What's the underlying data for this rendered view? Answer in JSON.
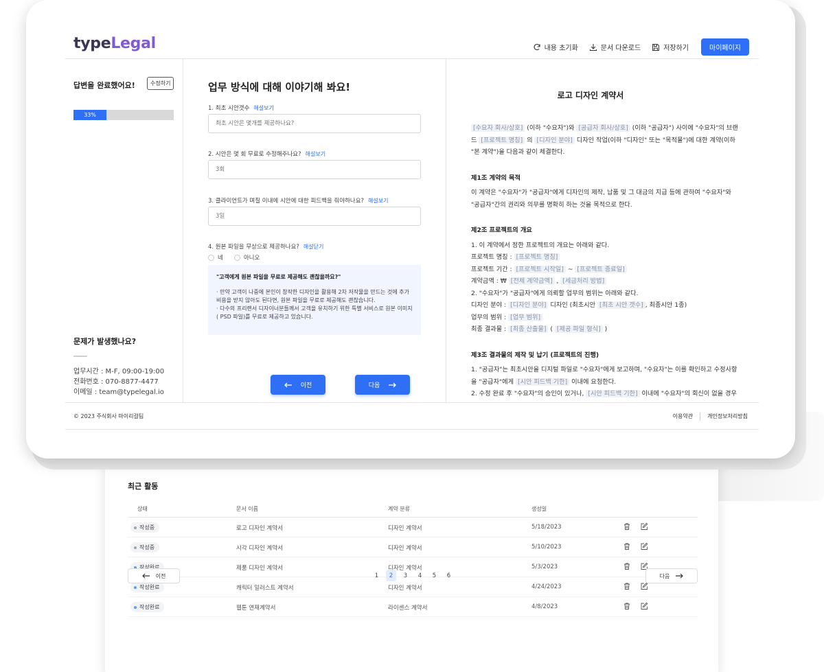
{
  "header": {
    "logo_part1": "type",
    "logo_part2": "Legal",
    "reset_label": "내용 초기화",
    "download_label": "문서 다운로드",
    "save_label": "저장하기",
    "mypage_label": "마이페이지"
  },
  "sidebar": {
    "done_text": "답변을 완료했어요!",
    "edit_label": "수정하기",
    "progress_label": "33%",
    "progress_value": 0.33,
    "problem_title": "문제가 발생했나요?",
    "hours": "업무시간 : M-F, 09:00-19:00",
    "phone": "전화번호 : 070-8877-4477",
    "email": "이메일 : team@typelegal.io"
  },
  "questions": {
    "title": "업무 방식에 대해 이야기해 봐요!",
    "hint_show": "해설보기",
    "hint_hide": "해설닫기",
    "q1_label": "1. 최초 시안갯수",
    "q1_placeholder": "최초 시안은 몇개를 제공하나요?",
    "q2_label": "2. 시안은 몇 회 무료로 수정해주나요?",
    "q2_placeholder": "3회",
    "q3_label": "3. 클라이언트가 며칠 이내에 시안에 대한 피드백을 줘야하나요?",
    "q3_placeholder": "3일",
    "q4_label": "4. 원본 파일을 무상으로 제공하나요?",
    "yes_label": "네",
    "no_label": "아니오",
    "tip_question": "\"고객에게 원본 파일을 무료로 제공해도 괜찮을까요?\"",
    "tip_line1": "· 만약 고객이 나중에 본인이 창작한 디자인을 활용해 2차 저작물을 만드는 것에 추가 비용을 받지 않아도 된다면, 원본 파일을 무료로 제공해도 괜찮습니다.",
    "tip_line2": "· 다수의 프리랜서 디자이너분들께서 고객을 유치하기 위한 특별 서비스로 원본 이미지( PSD 파일)를 무료로 제공하고 있습니다.",
    "prev_label": "이전",
    "next_label": "다음"
  },
  "document": {
    "title": "로고 디자인 계약서",
    "ph_client": "[수요자 회사/상호]",
    "t_intro1": " (이하 \"수요자\")와 ",
    "ph_provider": "[공급자 회사/상호]",
    "t_intro2": " (이하 \"공급자\") 사이에 \"수요자\"의 브랜드 ",
    "ph_project": "[프로젝트 명칭]",
    "t_intro3": " 의 ",
    "ph_field": "[디자인 분야]",
    "t_intro4": " 디자인 작업(이하 \"디자인\" 또는 \"목적물\")에 대한 계약(이하 \"본 계약\")을 다음과 같이 체결한다.",
    "sec1_title": "제1조 계약의 목적",
    "sec1_body": "이 계약은 \"수요자\"가 \"공급자\"에게 디자인의 제작, 납품 및 그 대금의 지급 등에 관하여 \"수요자\"와 \"공급자\"간의 권리와 의무를 명확히 하는 것을 목적으로 한다.",
    "sec2_title": "제2조 프로젝트의 개요",
    "sec2_l1": "1. 이 계약에서 정한 프로젝트의 개요는 아래와 같다.",
    "sec2_name_label": "프로젝트 명칭 : ",
    "ph_project2": "[프로젝트 명칭]",
    "sec2_period_label": "프로젝트 기간 : ",
    "ph_start": "[프로젝트 시작일]",
    "t_dash": " ~ ",
    "ph_end": "[프로젝트 종료일]",
    "sec2_amount_label": "계약금액 : ₩ ",
    "ph_amount": "[전체 계약금액]",
    "t_comma": " , ",
    "ph_tax": "[세금처리 방법]",
    "sec2_l2": "2. \"수요자\"가 \"공급자\"에게 의뢰할 업무의 범위는 아래와 같다.",
    "sec2_field_label": "디자인 분야 : ",
    "ph_field2": "[디자인 분야]",
    "t_field_mid": " 디자인 (최초시안 ",
    "ph_count": "[최초 시안 갯수]",
    "t_field_end": ", 최종시안 1종)",
    "sec2_scope_label": "업무의 범위 : ",
    "ph_scope": "[업무 범위]",
    "sec2_result_label": "최종 결과물 : ",
    "ph_result": "[최종 산출물]",
    "t_paren_open": " ( ",
    "ph_format": "[제공 파일 형식]",
    "t_paren_close": " )",
    "sec3_title": "제3조 결과물의 제작 및 납기 (프로젝트의 진행)",
    "sec3_l1": "1. \"공급자\"는 최초시안을 디지털 파일로 \"수요자\"에게 보고하며, \"수요자\"는 이를 확인하고 수정사항을 \"공급자\"에게 ",
    "ph_feedback": "[시안 피드백 기한]",
    "sec3_l1_end": " 이내에 요청한다.",
    "sec3_l2": "2. 수정 완료 후 \"수요자\"의 승인이 있거나, ",
    "ph_feedback2": "[시안 피드백 기한]",
    "sec3_l2_end": " 이내에 \"수요자\"의 회신이 없을 경우 해당 시안은 통과한 것으로 간주한다."
  },
  "footer": {
    "copyright": "© 2023 주식회사 마이리걸팀",
    "terms": "이용약관",
    "privacy": "개인정보처리방침"
  },
  "activity": {
    "title": "최근 활동",
    "columns": [
      "상태",
      "문서 이름",
      "계약 분류",
      "생성일"
    ],
    "rows": [
      {
        "status": "작성중",
        "name": "로고 디자인 계약서",
        "category": "디자인 계약서",
        "date": "5/18/2023"
      },
      {
        "status": "작성중",
        "name": "시각 디자인 계약서",
        "category": "디자인 계약서",
        "date": "5/10/2023"
      },
      {
        "status": "작성완료",
        "name": "제품 디자인 계약서",
        "category": "디자인 계약서",
        "date": "5/3/2023"
      },
      {
        "status": "작성완료",
        "name": "캐릭터 일러스트 계약서",
        "category": "디자인 계약서",
        "date": "4/24/2023"
      },
      {
        "status": "작성완료",
        "name": "웹툰 연재계약서",
        "category": "라이센스 계약서",
        "date": "4/8/2023"
      }
    ],
    "prev_label": "이전",
    "next_label": "다음",
    "pages": [
      "1",
      "2",
      "3",
      "4",
      "5",
      "6"
    ],
    "current_page": "2"
  },
  "colors": {
    "accent": "#2f6ff5",
    "logo_dark": "#3b3557",
    "logo_accent": "#7f5bd6",
    "status_progress": "#9aa3b8",
    "status_done": "#5aa0f0"
  },
  "icons": [
    "refresh-icon",
    "download-icon",
    "save-icon",
    "arrow-left-icon",
    "arrow-right-icon",
    "trash-icon",
    "edit-icon"
  ]
}
